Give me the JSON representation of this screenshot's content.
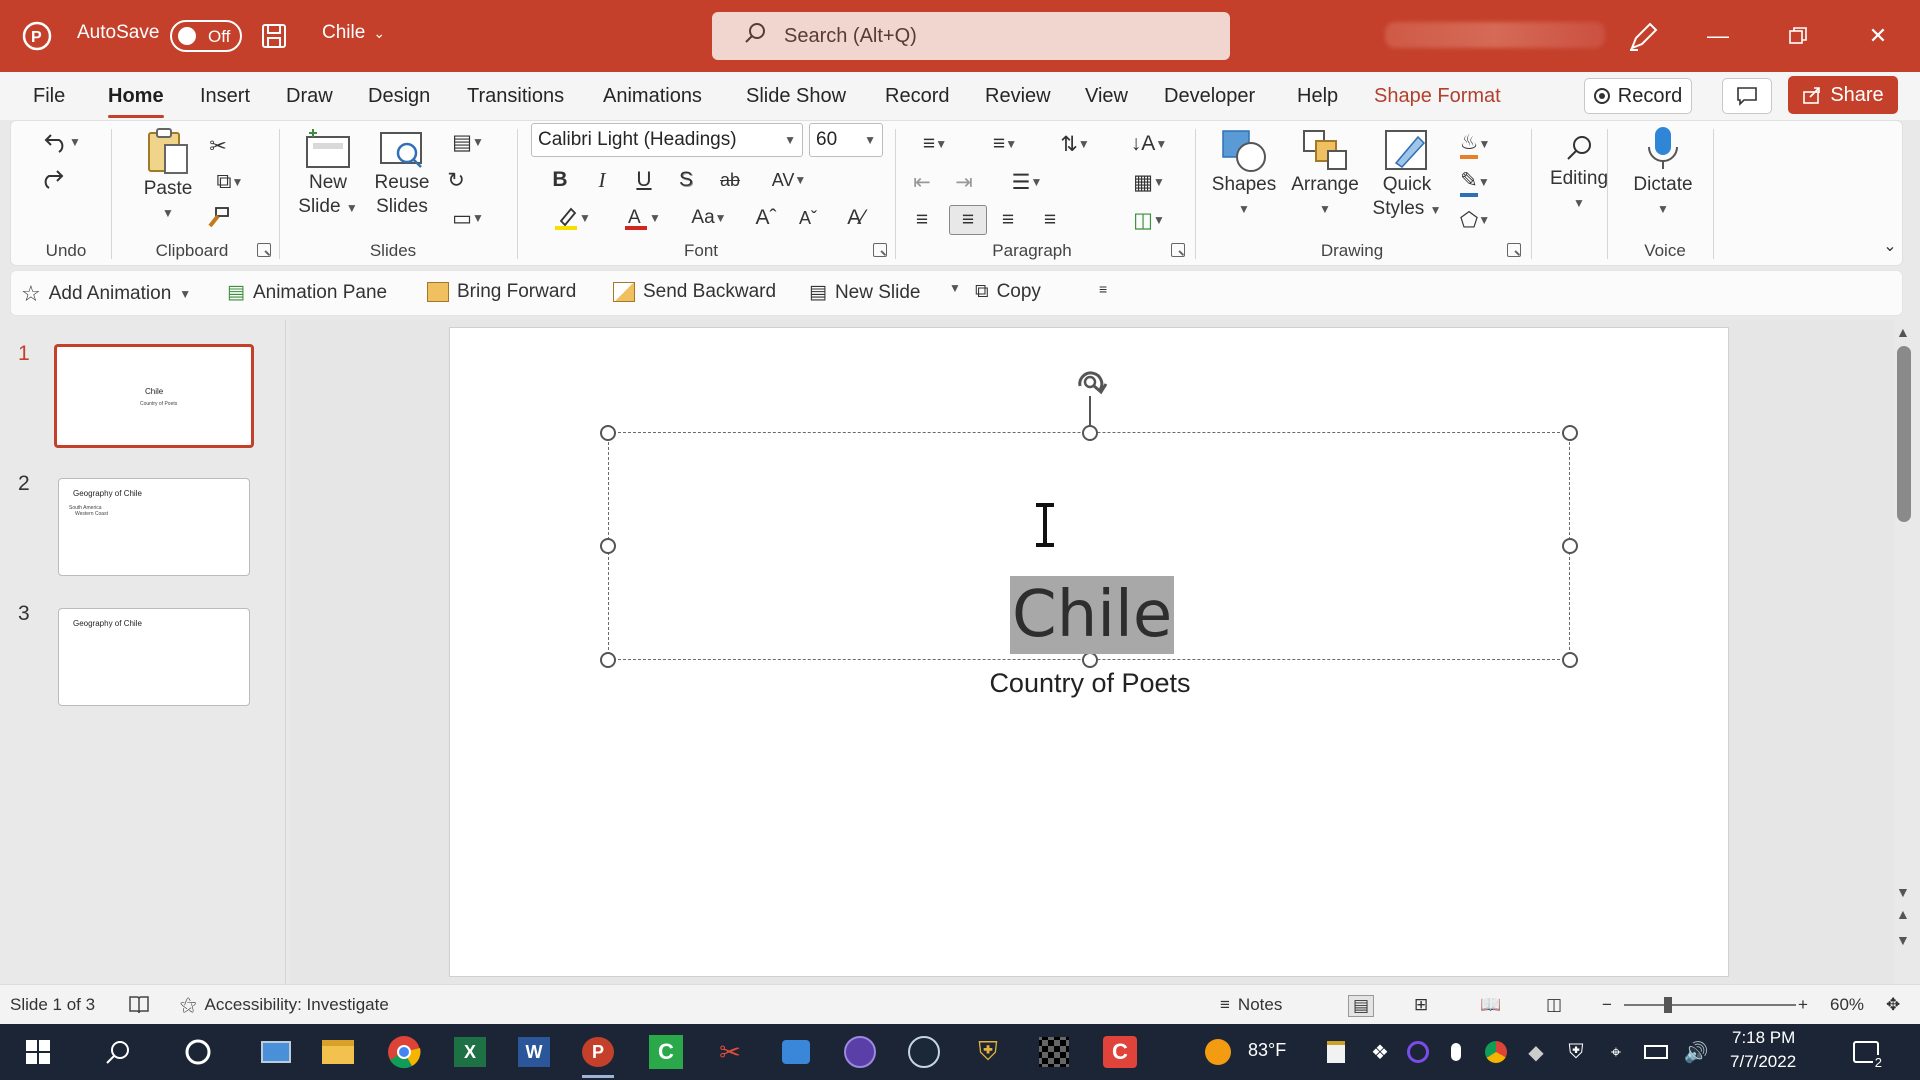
{
  "titlebar": {
    "autosave_label": "AutoSave",
    "autosave_state": "Off",
    "doc_title": "Chile",
    "search_placeholder": "Search (Alt+Q)",
    "accent": "#c4402b"
  },
  "menu": {
    "tabs": [
      "File",
      "Home",
      "Insert",
      "Draw",
      "Design",
      "Transitions",
      "Animations",
      "Slide Show",
      "Record",
      "Review",
      "View",
      "Developer",
      "Help",
      "Shape Format"
    ],
    "active_tab": "Home",
    "record_label": "Record",
    "share_label": "Share"
  },
  "ribbon": {
    "groups": {
      "undo": "Undo",
      "clipboard": "Clipboard",
      "slides": "Slides",
      "font": "Font",
      "paragraph": "Paragraph",
      "drawing": "Drawing",
      "voice": "Voice"
    },
    "paste": "Paste",
    "new_slide": [
      "New",
      "Slide"
    ],
    "reuse_slides": [
      "Reuse",
      "Slides"
    ],
    "font_name": "Calibri Light (Headings)",
    "font_size": "60",
    "shapes": "Shapes",
    "arrange": "Arrange",
    "quick_styles": [
      "Quick",
      "Styles"
    ],
    "editing": "Editing",
    "dictate": "Dictate"
  },
  "qat": {
    "items": [
      "Add Animation",
      "Animation Pane",
      "Bring Forward",
      "Send Backward",
      "New Slide",
      "Copy"
    ]
  },
  "thumbnails": [
    {
      "number": "1",
      "title": "Chile",
      "subtitle": "Country of Poets"
    },
    {
      "number": "2",
      "title": "Geography of Chile",
      "bullets": [
        "South America",
        "Western Coast"
      ]
    },
    {
      "number": "3",
      "title": "Geography of Chile"
    }
  ],
  "slide": {
    "title": "Chile",
    "subtitle": "Country of Poets"
  },
  "status": {
    "slide_info": "Slide 1 of 3",
    "accessibility": "Accessibility: Investigate",
    "notes": "Notes",
    "zoom": "60%"
  },
  "taskbar": {
    "temperature": "83°F",
    "time": "7:18 PM",
    "date": "7/7/2022",
    "notifications": "2"
  }
}
